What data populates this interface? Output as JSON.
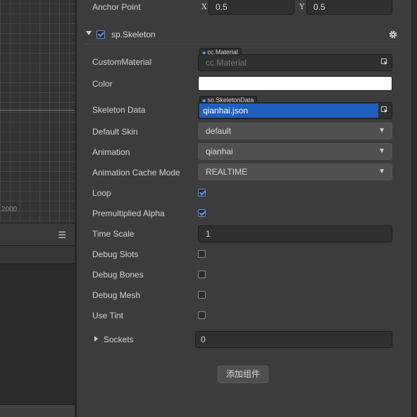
{
  "scene": {
    "axis_label": "2000"
  },
  "anchor": {
    "label": "Anchor Point",
    "x_label": "X",
    "x_value": "0.5",
    "y_label": "Y",
    "y_value": "0.5"
  },
  "component": {
    "name": "sp.Skeleton",
    "enabled": true
  },
  "props": {
    "custom_material": {
      "label": "CustomMaterial",
      "tag": "cc.Material",
      "placeholder": "cc.Material"
    },
    "color": {
      "label": "Color",
      "value": "#ffffff"
    },
    "skeleton_data": {
      "label": "Skeleton Data",
      "tag": "sp.SkeletonData",
      "value": "qianhai.json"
    },
    "default_skin": {
      "label": "Default Skin",
      "value": "default"
    },
    "animation": {
      "label": "Animation",
      "value": "qianhai"
    },
    "cache_mode": {
      "label": "Animation Cache Mode",
      "value": "REALTIME"
    },
    "loop": {
      "label": "Loop",
      "checked": true
    },
    "premultiplied_alpha": {
      "label": "Premultiplied Alpha",
      "checked": true
    },
    "time_scale": {
      "label": "Time Scale",
      "value": "1"
    },
    "debug_slots": {
      "label": "Debug Slots",
      "checked": false
    },
    "debug_bones": {
      "label": "Debug Bones",
      "checked": false
    },
    "debug_mesh": {
      "label": "Debug Mesh",
      "checked": false
    },
    "use_tint": {
      "label": "Use Tint",
      "checked": false
    },
    "sockets": {
      "label": "Sockets",
      "value": "0"
    }
  },
  "add_component_label": "添加组件",
  "colors": {
    "accent": "#1e5fbf",
    "checkbox": "#5f9cff"
  }
}
